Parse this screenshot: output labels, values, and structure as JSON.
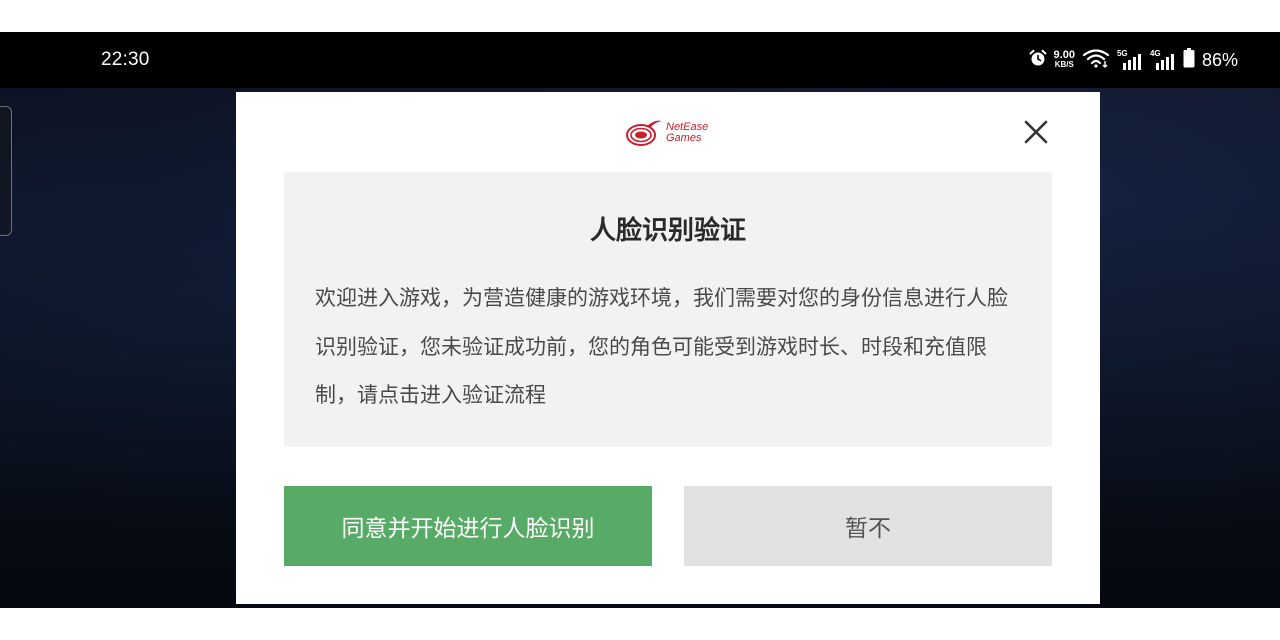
{
  "status_bar": {
    "time": "22:30",
    "net_speed_value": "9.00",
    "net_speed_unit": "KB/S",
    "signal_1_label": "5G",
    "signal_2_label": "4G",
    "battery": "86%",
    "icons": [
      "alarm-icon",
      "wifi-icon",
      "signal-5g-icon",
      "signal-4g-icon",
      "battery-icon"
    ]
  },
  "dialog": {
    "logo_line1": "NetEase",
    "logo_line2": "Games",
    "title": "人脸识别验证",
    "body": "欢迎进入游戏，为营造健康的游戏环境，我们需要对您的身份信息进行人脸识别验证，您未验证成功前，您的角色可能受到游戏时长、时段和充值限制，请点击进入验证流程",
    "agree_button": "同意并开始进行人脸识别",
    "later_button": "暂不",
    "close_icon": "close-icon"
  },
  "colors": {
    "agree_button_bg": "#57ab66",
    "later_button_bg": "#e2e2e2",
    "info_box_bg": "#f2f2f2",
    "logo_red": "#c6202e"
  }
}
